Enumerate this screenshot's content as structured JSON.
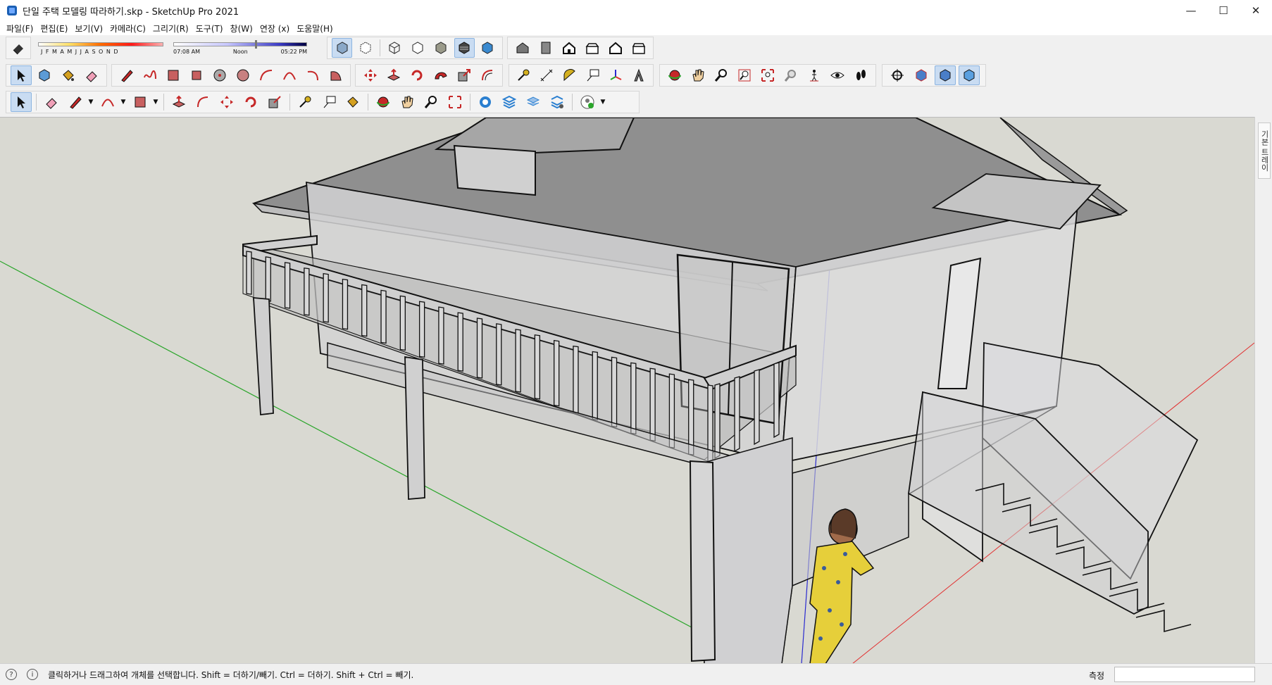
{
  "window": {
    "title": "단일 주택 모델링 따라하기.skp - SketchUp Pro 2021",
    "minimize_glyph": "—",
    "maximize_glyph": "☐",
    "close_glyph": "✕"
  },
  "menu": [
    {
      "label": "파일(F)"
    },
    {
      "label": "편집(E)"
    },
    {
      "label": "보기(V)"
    },
    {
      "label": "카메라(C)"
    },
    {
      "label": "그리기(R)"
    },
    {
      "label": "도구(T)"
    },
    {
      "label": "창(W)"
    },
    {
      "label": "연장 (x)"
    },
    {
      "label": "도움말(H)"
    }
  ],
  "shadow": {
    "months": [
      "J",
      "F",
      "M",
      "A",
      "M",
      "J",
      "J",
      "A",
      "S",
      "O",
      "N",
      "D"
    ],
    "time_start": "07:08 AM",
    "time_mid": "Noon",
    "time_end": "05:22 PM"
  },
  "tray": {
    "label": "기본 트레이"
  },
  "status": {
    "info_glyph": "i",
    "help_glyph": "?",
    "message": "클릭하거나 드래그하여 개체를 선택합니다. Shift = 더하기/빼기. Ctrl = 더하기. Shift + Ctrl = 빼기.",
    "measure_label": "측정",
    "measure_value": ""
  },
  "colors": {
    "viewport_bg": "#d9d9d2",
    "axis_red": "#e23030",
    "axis_green": "#2aa52a",
    "axis_blue": "#2a2ad0",
    "active_button": "#c9dcf2"
  }
}
